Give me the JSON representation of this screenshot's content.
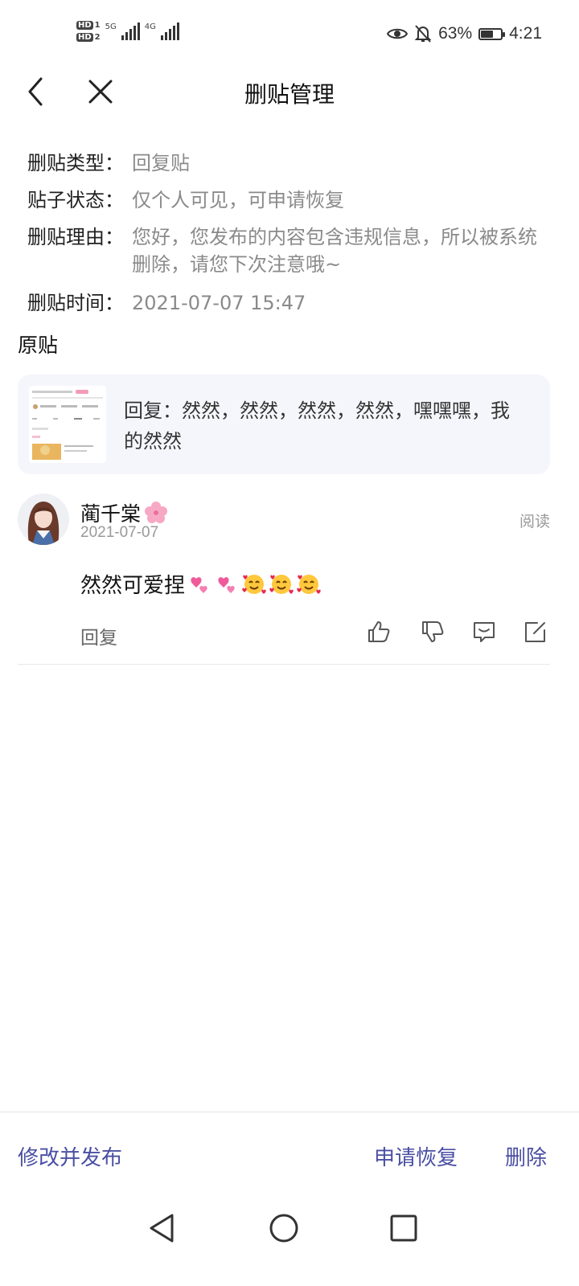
{
  "status_bar": {
    "sim1": "HD",
    "sim1_index": "1",
    "sim2": "HD",
    "sim2_index": "2",
    "net1": "5G",
    "net2": "4G",
    "battery_percent": "63%",
    "battery_level": 0.63,
    "time": "4:21"
  },
  "header": {
    "title": "删贴管理"
  },
  "info": {
    "type_label": "删贴类型：",
    "type_value": "回复贴",
    "status_label": "贴子状态：",
    "status_value": "仅个人可见，可申请恢复",
    "reason_label": "删贴理由：",
    "reason_value": "您好，您发布的内容包含违规信息，所以被系统删除，请您下次注意哦~",
    "time_label": "删贴时间：",
    "time_value": "2021-07-07 15:47"
  },
  "original": {
    "section_title": "原贴",
    "card_text": "回复：然然，然然，然然，然然，嘿嘿嘿，我的然然"
  },
  "reply": {
    "username": "蔺千棠",
    "date": "2021-07-07",
    "read_label": "阅读",
    "content": "然然可爱捏",
    "reply_label": "回复"
  },
  "footer": {
    "edit_publish": "修改并发布",
    "request_restore": "申请恢复",
    "delete": "删除"
  },
  "colors": {
    "accent": "#4a4fa3",
    "card_bg": "#f5f6fb",
    "muted_text": "#8a8a8a"
  }
}
